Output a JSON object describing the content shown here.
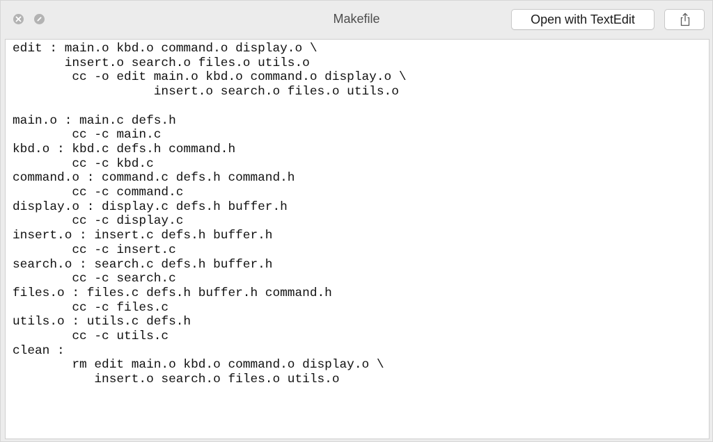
{
  "window": {
    "title": "Makefile"
  },
  "toolbar": {
    "open_with_label": "Open with TextEdit",
    "share_icon": "share-icon",
    "close_icon": "close-icon",
    "minimize_icon": "minimize-icon"
  },
  "file": {
    "contents": "edit : main.o kbd.o command.o display.o \\\n       insert.o search.o files.o utils.o\n        cc -o edit main.o kbd.o command.o display.o \\\n                   insert.o search.o files.o utils.o\n\nmain.o : main.c defs.h\n        cc -c main.c\nkbd.o : kbd.c defs.h command.h\n        cc -c kbd.c\ncommand.o : command.c defs.h command.h\n        cc -c command.c\ndisplay.o : display.c defs.h buffer.h\n        cc -c display.c\ninsert.o : insert.c defs.h buffer.h\n        cc -c insert.c\nsearch.o : search.c defs.h buffer.h\n        cc -c search.c\nfiles.o : files.c defs.h buffer.h command.h\n        cc -c files.c\nutils.o : utils.c defs.h\n        cc -c utils.c\nclean :\n        rm edit main.o kbd.o command.o display.o \\\n           insert.o search.o files.o utils.o"
  }
}
